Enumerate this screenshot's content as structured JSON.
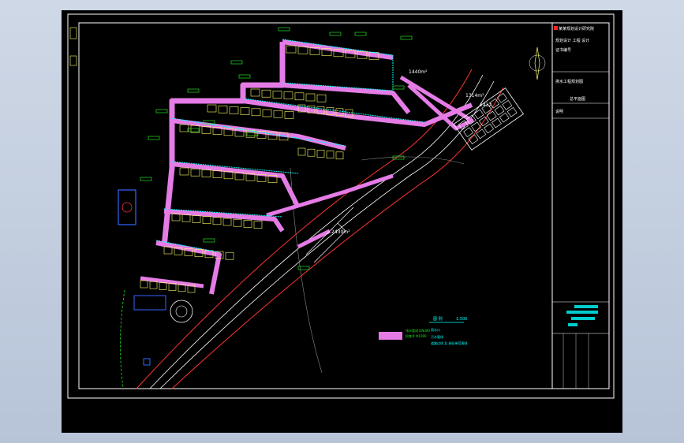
{
  "drawing": {
    "area_labels": {
      "area_a": "1314m²",
      "area_b": "1440m²",
      "area_c": "2430m²",
      "area_d": "1432",
      "area_e": "1440m²"
    },
    "legend": {
      "title": "图 例",
      "scale_note": "1:500",
      "items": [
        "排水管线 DN300",
        "检查井 Φ1000",
        "雨水口",
        "污水管线",
        "道路边线 及 绿化带范围线"
      ]
    },
    "title_block": {
      "company_lines": [
        "某某规划设计研究院",
        "规划设计 工程 设计",
        "证书编号"
      ],
      "project_label": "排水工程规划图",
      "drawing_title": "总平面图",
      "notes_label": "说明",
      "signoff_rows": [
        "审定",
        "审核",
        "校对",
        "设计",
        "制图",
        "日期"
      ]
    }
  },
  "colors": {
    "road_fill": "#e57ce6",
    "building": "#ffff66",
    "pipe": "#00ffff",
    "tag": "#22dd22",
    "frame": "#ffffff",
    "curb": "#ff3333"
  },
  "icons": [
    "north-arrow-icon",
    "roundabout-icon"
  ]
}
